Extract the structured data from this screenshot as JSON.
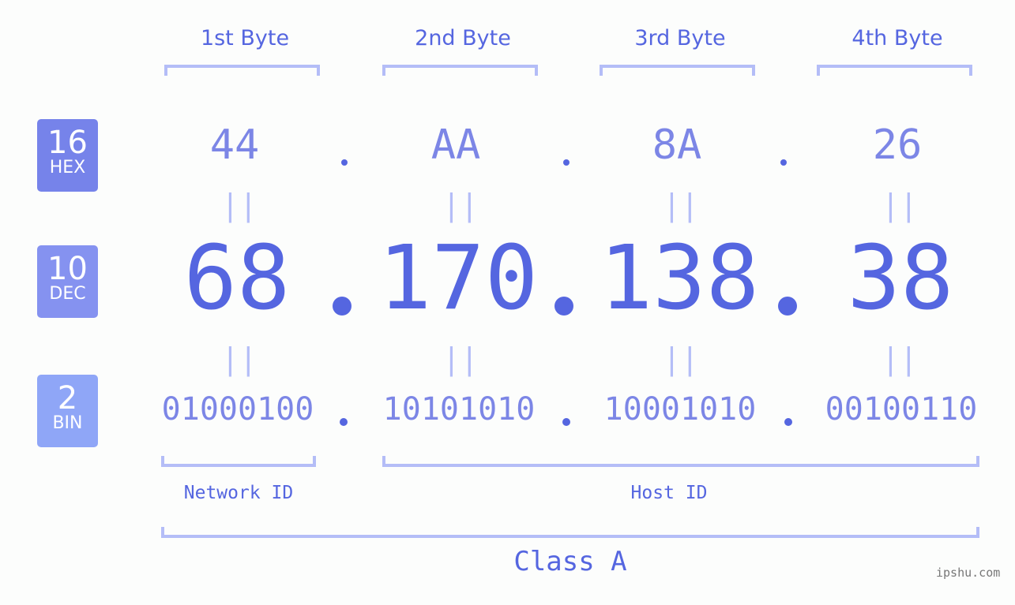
{
  "byte_headers": [
    "1st Byte",
    "2nd Byte",
    "3rd Byte",
    "4th Byte"
  ],
  "badges": [
    {
      "num": "16",
      "name": "HEX",
      "color": "#7683ea"
    },
    {
      "num": "10",
      "name": "DEC",
      "color": "#8592f0"
    },
    {
      "num": "2",
      "name": "BIN",
      "color": "#8fa6f7"
    }
  ],
  "hex": [
    "44",
    "AA",
    "8A",
    "26"
  ],
  "dec": [
    "68",
    "170",
    "138",
    "38"
  ],
  "bin": [
    "01000100",
    "10101010",
    "10001010",
    "00100110"
  ],
  "equals_glyph": "||",
  "network_label": "Network ID",
  "host_label": "Host ID",
  "class_label": "Class A",
  "watermark": "ipshu.com",
  "colors": {
    "accent": "#5566e0",
    "light": "#b4bdf7",
    "mid": "#7c86e6"
  }
}
